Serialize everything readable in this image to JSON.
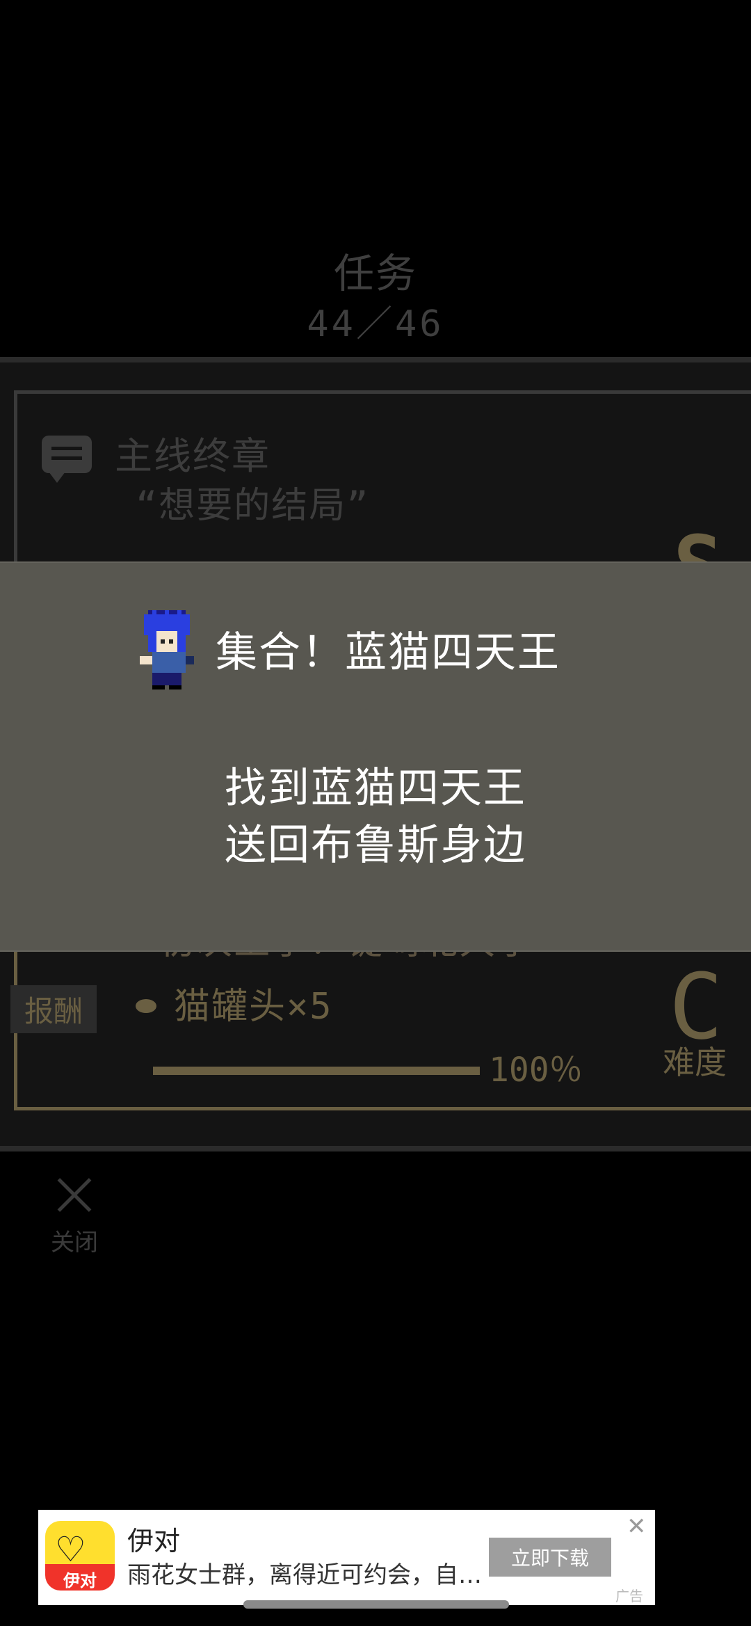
{
  "header": {
    "title": "任务",
    "count": "44／46"
  },
  "quests": [
    {
      "category": "主线终章",
      "name": "“想要的结局”",
      "reward_label": "报酬",
      "reward_value": "？？？？？",
      "difficulty": "S"
    },
    {
      "name": "“初次上学！锭崎北大学”",
      "reward_label": "报酬",
      "reward_item": "猫罐头×5",
      "progress": "100％",
      "difficulty": "C",
      "difficulty_label": "难度"
    }
  ],
  "popup": {
    "title": "集合！蓝猫四天王",
    "body_line1": "找到蓝猫四天王",
    "body_line2": "送回布鲁斯身边"
  },
  "close": {
    "label": "关闭"
  },
  "ad": {
    "app_name": "伊对",
    "logo_label": "伊对",
    "description": "雨花女士群，离得近可约会，自…",
    "button": "立即下载",
    "tag": "广告"
  }
}
